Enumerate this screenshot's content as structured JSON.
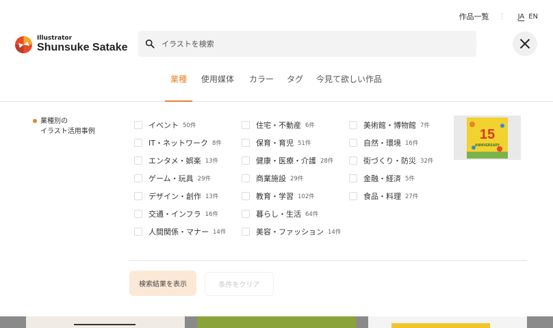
{
  "header": {
    "works_link": "作品一覧",
    "lang_ja": "JA",
    "lang_en": "EN",
    "logo_sub": "Illustrator",
    "logo_main": "Shunsuke Satake"
  },
  "search": {
    "placeholder": "イラストを検索"
  },
  "tabs": [
    {
      "label": "業種",
      "active": true
    },
    {
      "label": "使用媒体"
    },
    {
      "label": "カラー"
    },
    {
      "label": "タグ"
    },
    {
      "label": "今見て欲しい作品"
    }
  ],
  "sidebar": {
    "line1": "業種別の",
    "line2": "イラスト活用事例"
  },
  "columns": [
    [
      {
        "label": "イベント",
        "count": "50件"
      },
      {
        "label": "IT・ネットワーク",
        "count": "8件"
      },
      {
        "label": "エンタメ・娯楽",
        "count": "13件"
      },
      {
        "label": "ゲーム・玩具",
        "count": "29件"
      },
      {
        "label": "デザイン・創作",
        "count": "13件"
      },
      {
        "label": "交通・インフラ",
        "count": "16件"
      },
      {
        "label": "人間関係・マナー",
        "count": "14件"
      }
    ],
    [
      {
        "label": "住宅・不動産",
        "count": "6件"
      },
      {
        "label": "保育・育児",
        "count": "51件"
      },
      {
        "label": "健康・医療・介護",
        "count": "28件"
      },
      {
        "label": "商業施設",
        "count": "29件"
      },
      {
        "label": "教育・学習",
        "count": "102件"
      },
      {
        "label": "暮らし・生活",
        "count": "64件"
      },
      {
        "label": "美容・ファッション",
        "count": "14件"
      }
    ],
    [
      {
        "label": "美術館・博物館",
        "count": "7件"
      },
      {
        "label": "自然・環境",
        "count": "16件"
      },
      {
        "label": "街づくり・防災",
        "count": "32件"
      },
      {
        "label": "金融・経済",
        "count": "5件"
      },
      {
        "label": "食品・料理",
        "count": "27件"
      }
    ]
  ],
  "thumbnail": {
    "number": "15",
    "caption": "ANNIVERSARY"
  },
  "actions": {
    "search_results": "検索結果を表示",
    "clear": "条件をクリア"
  },
  "colors": {
    "accent": "#e8832a",
    "button_bg": "#fbe8d6"
  }
}
